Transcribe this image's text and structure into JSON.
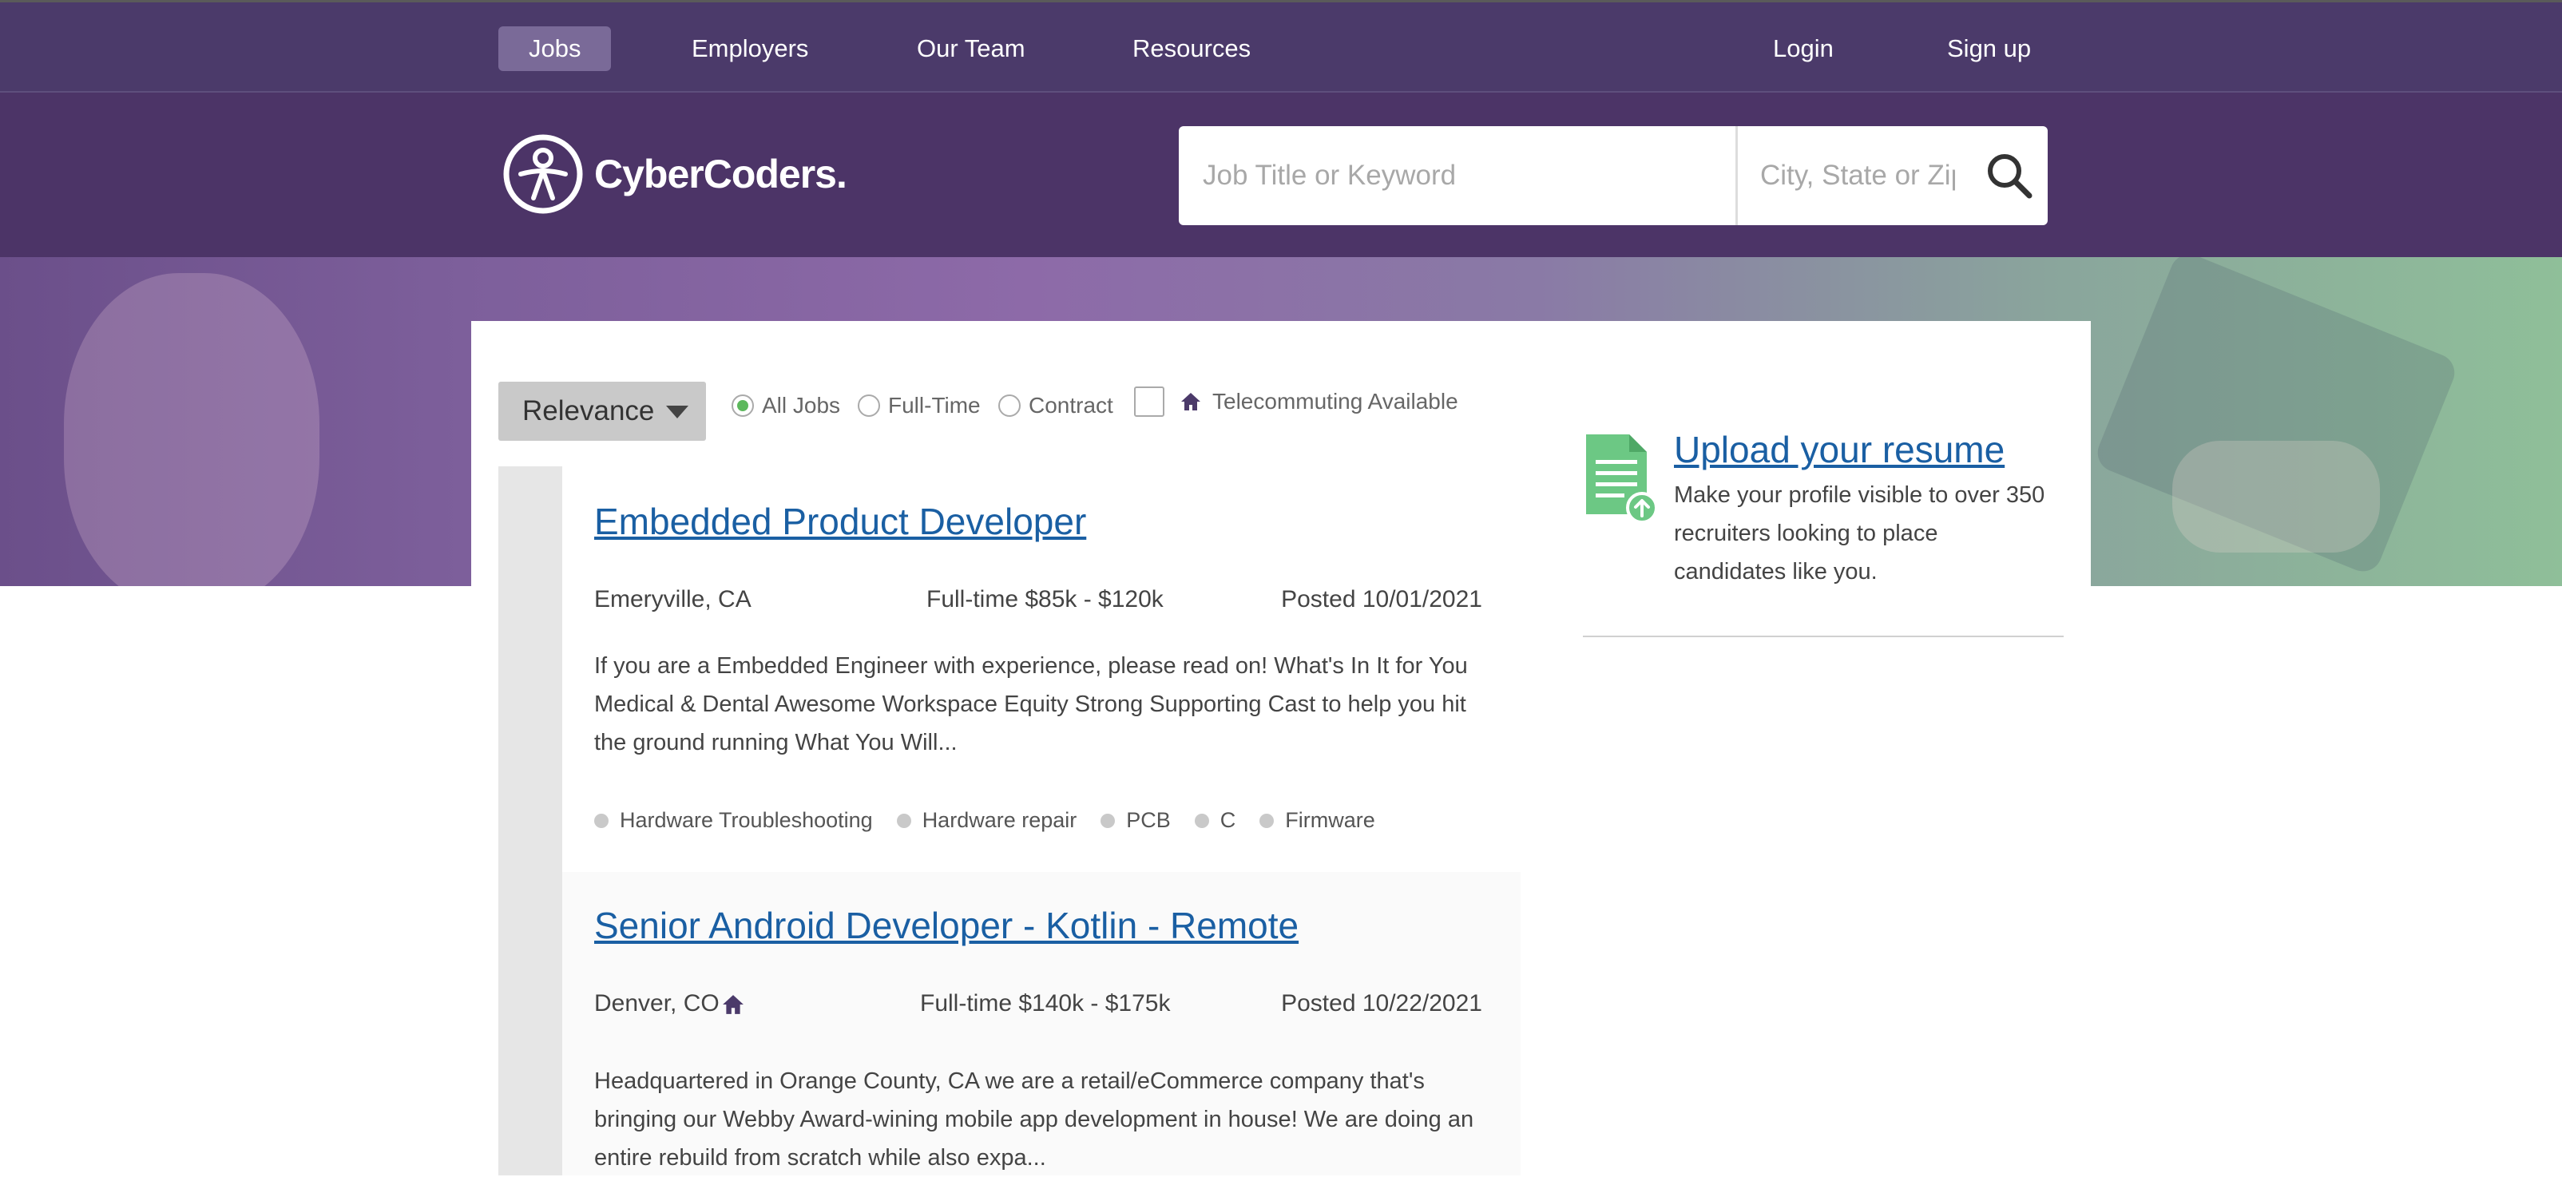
{
  "topnav": {
    "items": [
      "Jobs",
      "Employers",
      "Our Team",
      "Resources"
    ],
    "active": "Jobs",
    "login": "Login",
    "signup": "Sign up"
  },
  "header": {
    "logo_text": "CyberCoders.",
    "search": {
      "keyword_placeholder": "Job Title or Keyword",
      "location_placeholder": "City, State or Zip"
    }
  },
  "filters": {
    "sort": "Relevance",
    "job_types": [
      "All Jobs",
      "Full-Time",
      "Contract"
    ],
    "selected_job_type": "All Jobs",
    "telecommute_label": "Telecommuting Available",
    "telecommute_checked": false
  },
  "jobs": [
    {
      "title": "Embedded Product Developer",
      "location": "Emeryville, CA",
      "remote": false,
      "type_salary": "Full-time $85k - $120k",
      "posted": "Posted 10/01/2021",
      "description": "If you are a Embedded Engineer with experience, please read on! What's In It for You Medical & Dental Awesome Workspace Equity Strong Supporting Cast to help you hit the ground running What You Will...",
      "tags": [
        "Hardware Troubleshooting",
        "Hardware repair",
        "PCB",
        "C",
        "Firmware"
      ]
    },
    {
      "title": "Senior Android Developer - Kotlin - Remote",
      "location": "Denver, CO",
      "remote": true,
      "type_salary": "Full-time $140k - $175k",
      "posted": "Posted 10/22/2021",
      "description": "Headquartered in Orange County, CA we are a retail/eCommerce company that's bringing our Webby Award-wining mobile app development in house! We are doing an entire rebuild from scratch while also expa..."
    }
  ],
  "sidebar": {
    "upload_title": "Upload your resume",
    "upload_text": "Make your profile visible to over 350 recruiters looking to place candidates like you."
  },
  "colors": {
    "nav_bg": "#4b3a6a",
    "header_bg": "#4c3467",
    "link": "#1a5fa3",
    "accent_green": "#5cb85c",
    "house_icon": "#4b3a6a"
  }
}
